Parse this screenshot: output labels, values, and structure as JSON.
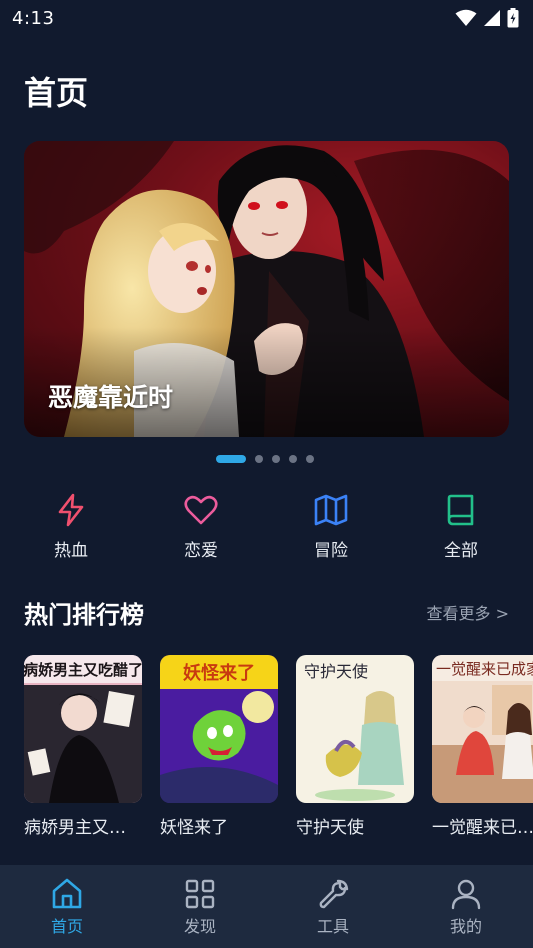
{
  "status": {
    "time": "4:13"
  },
  "page_title": "首页",
  "banner": {
    "title": "恶魔靠近时",
    "slides": 5,
    "active_slide": 1
  },
  "categories": [
    {
      "label": "热血",
      "icon": "lightning-icon",
      "color": "#f0506e"
    },
    {
      "label": "恋爱",
      "icon": "heart-icon",
      "color": "#ec5c9c"
    },
    {
      "label": "冒险",
      "icon": "map-icon",
      "color": "#3b82f6"
    },
    {
      "label": "全部",
      "icon": "book-icon",
      "color": "#22c08a"
    }
  ],
  "ranking": {
    "title": "热门排行榜",
    "more": "查看更多 >",
    "books": [
      {
        "title": "病娇男主又…",
        "cover_text": "病娇男主又吃醋了"
      },
      {
        "title": "妖怪来了",
        "cover_text": "妖怪来了"
      },
      {
        "title": "守护天使",
        "cover_text": "守护天使"
      },
      {
        "title": "一觉醒来已…",
        "cover_text": "一觉醒来已成家"
      }
    ]
  },
  "nav": [
    {
      "label": "首页",
      "icon": "home-icon",
      "active": true
    },
    {
      "label": "发现",
      "icon": "grid-icon",
      "active": false
    },
    {
      "label": "工具",
      "icon": "wrench-icon",
      "active": false
    },
    {
      "label": "我的",
      "icon": "user-icon",
      "active": false
    }
  ],
  "colors": {
    "accent": "#2fa8e6",
    "background": "#111a2e",
    "nav_background": "#1e2a3f"
  }
}
